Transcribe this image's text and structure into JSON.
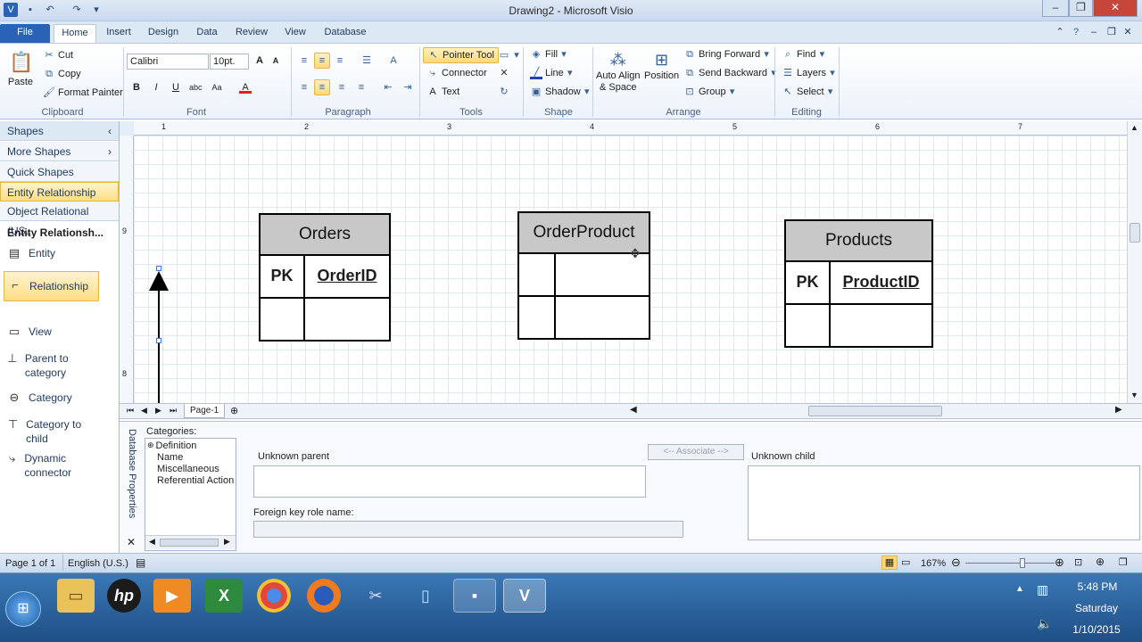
{
  "window": {
    "title": "Drawing2 - Microsoft Visio"
  },
  "qat": {
    "save": "save-icon",
    "undo": "undo-icon",
    "redo": "redo-icon"
  },
  "tabs": [
    "File",
    "Home",
    "Insert",
    "Design",
    "Data",
    "Review",
    "View",
    "Database"
  ],
  "ribbon": {
    "clipboard": {
      "paste": "Paste",
      "cut": "Cut",
      "copy": "Copy",
      "format_painter": "Format Painter",
      "label": "Clipboard"
    },
    "font": {
      "font_name": "Calibri",
      "font_size": "10pt.",
      "label": "Font"
    },
    "paragraph": {
      "label": "Paragraph"
    },
    "tools": {
      "pointer": "Pointer Tool",
      "connector": "Connector",
      "text": "Text",
      "label": "Tools"
    },
    "shape": {
      "fill": "Fill",
      "line": "Line",
      "shadow": "Shadow",
      "label": "Shape"
    },
    "arrange": {
      "auto_align": "Auto Align",
      "space": "& Space",
      "position": "Position",
      "bring_forward": "Bring Forward",
      "send_backward": "Send Backward",
      "group": "Group",
      "label": "Arrange"
    },
    "editing": {
      "find": "Find",
      "layers": "Layers",
      "select": "Select",
      "label": "Editing"
    }
  },
  "shapes_pane": {
    "title": "Shapes",
    "more_shapes": "More Shapes",
    "quick_shapes": "Quick Shapes",
    "stencil_1": "Entity Relationship (U...",
    "stencil_2": "Object Relational (US...",
    "stencil_title": "Entity Relationsh...",
    "items": {
      "entity": "Entity",
      "relationship": "Relationship",
      "view": "View",
      "parent_to_category": "Parent to category",
      "category": "Category",
      "category_to_child": "Category to child",
      "dynamic_connector": "Dynamic connector"
    }
  },
  "ruler": {
    "h": [
      "1",
      "2",
      "3",
      "4",
      "5",
      "6",
      "7"
    ],
    "v": [
      "9",
      "8"
    ]
  },
  "entities": {
    "orders": {
      "name": "Orders",
      "pk": "PK",
      "key": "OrderID"
    },
    "orderproduct": {
      "name": "OrderProduct"
    },
    "products": {
      "name": "Products",
      "pk": "PK",
      "key": "ProductID"
    }
  },
  "page_tab": "Page-1",
  "properties": {
    "vertical_tab": "Database Properties",
    "categories_label": "Categories:",
    "categories": [
      "Definition",
      "Name",
      "Miscellaneous",
      "Referential Action"
    ],
    "unknown_parent": "Unknown parent",
    "associate": "<-- Associate -->",
    "unknown_child": "Unknown child",
    "fk_role": "Foreign key role name:"
  },
  "status": {
    "page": "Page 1 of 1",
    "language": "English (U.S.)",
    "zoom": "167%",
    "zoom_level": 0.65
  },
  "taskbar": {
    "time": "5:48 PM",
    "day": "Saturday",
    "date": "1/10/2015",
    "hp": "hp"
  },
  "colors": {
    "accent": "#2a62b8",
    "highlight": "#ffd978",
    "taskbar": "#1f4f86"
  }
}
